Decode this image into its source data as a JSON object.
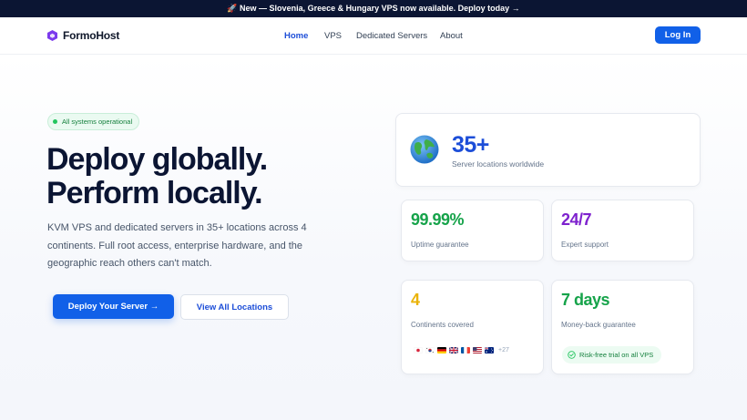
{
  "announcement": {
    "icon": "rocket-icon",
    "text": "🚀 New — Slovenia, Greece & Hungary VPS now available. Deploy today →"
  },
  "nav": {
    "brand": "FormoHost",
    "links": [
      {
        "label": "Home",
        "active": true
      },
      {
        "label": "VPS",
        "active": false
      },
      {
        "label": "Dedicated Servers",
        "active": false
      },
      {
        "label": "About",
        "active": false
      }
    ],
    "login_label": "Log In"
  },
  "hero": {
    "status": "All systems operational",
    "headline_line1": "Deploy globally.",
    "headline_line2": "Perform locally.",
    "lead": "KVM VPS and dedicated servers in 35+ locations across 4 continents. Full root access, enterprise hardware, and the geographic reach others can't match.",
    "primary_cta": "Deploy Your Server →",
    "secondary_cta": "View All Locations"
  },
  "stats": {
    "locations": {
      "value": "35+",
      "label": "Server locations worldwide",
      "icon": "globe-icon"
    },
    "uptime": {
      "value": "99.99%",
      "label": "Uptime guarantee",
      "color": "#16a34a"
    },
    "support": {
      "value": "24/7",
      "label": "Expert support",
      "color": "#7e22ce"
    },
    "continents": {
      "value": "4",
      "label": "Continents covered",
      "color": "#eab308",
      "flags": [
        "japan-flag",
        "south-korea-flag",
        "germany-flag",
        "uk-flag",
        "france-flag",
        "usa-flag",
        "australia-flag"
      ],
      "more": "+27"
    },
    "moneyback": {
      "value": "7 days",
      "label": "Money-back guarantee",
      "color": "#16a34a",
      "trial": "Risk-free trial on all VPS"
    }
  },
  "colors": {
    "brand": "#1160e8",
    "dark": "#0b1533",
    "success": "#22c55e"
  }
}
